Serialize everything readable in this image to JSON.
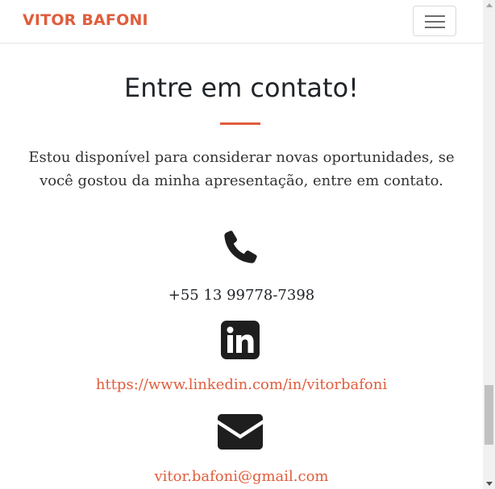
{
  "navbar": {
    "brand": "VITOR BAFONI",
    "toggler_icon": "hamburger-menu-icon"
  },
  "contact": {
    "title": "Entre em contato!",
    "lead": "Estou disponível para considerar novas oportunidades, se você gostou da minha apresentação, entre em contato.",
    "phone_icon": "phone-icon",
    "phone": "+55 13 99778-7398",
    "linkedin_icon": "linkedin-icon",
    "linkedin": "https://www.linkedin.com/in/vitorbafoni",
    "email_icon": "envelope-icon",
    "email": "vitor.bafoni@gmail.com"
  },
  "colors": {
    "accent": "#e05d3c",
    "text": "#212529",
    "icon": "#1e1e1e"
  }
}
